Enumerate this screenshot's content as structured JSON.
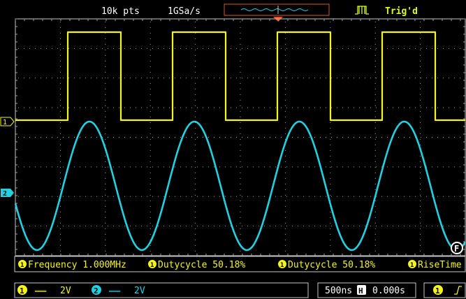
{
  "header": {
    "memory_depth": "10k pts",
    "sample_rate": "1GSa/s",
    "trigger_status": "Trig'd"
  },
  "channels": [
    {
      "id": "1",
      "color": "#f5f51a",
      "coupling_symbol": "═══",
      "scale": "2V"
    },
    {
      "id": "2",
      "color": "#22d0e0",
      "coupling_symbol": "═══",
      "scale": "2V"
    }
  ],
  "measurements": [
    {
      "channel": "1",
      "label": "Frequency 1.000MHz"
    },
    {
      "channel": "1",
      "label": "Dutycycle 50.18%"
    },
    {
      "channel": "1",
      "label": "Dutycycle 50.18%"
    },
    {
      "channel": "1",
      "label": "RiseTime"
    }
  ],
  "footer": {
    "timebase": "500ns",
    "horizontal_icon": "H",
    "horizontal_position": "0.000s",
    "trigger_source": "1",
    "trigger_slope_icon": "rising-edge-icon"
  },
  "side_key_label": "F",
  "colors": {
    "ch1": "#f5f51a",
    "ch2": "#22d0e0",
    "grid": "#a0a0a0",
    "frame": "#c8c8c8",
    "trigger_marker": "#ff4a1a",
    "trig_status": "#d8ff1a"
  },
  "waveforms": {
    "ch1": {
      "shape": "square",
      "frequency": "1.000MHz",
      "duty_cycle_percent": 50.18
    },
    "ch2": {
      "shape": "sine"
    }
  }
}
